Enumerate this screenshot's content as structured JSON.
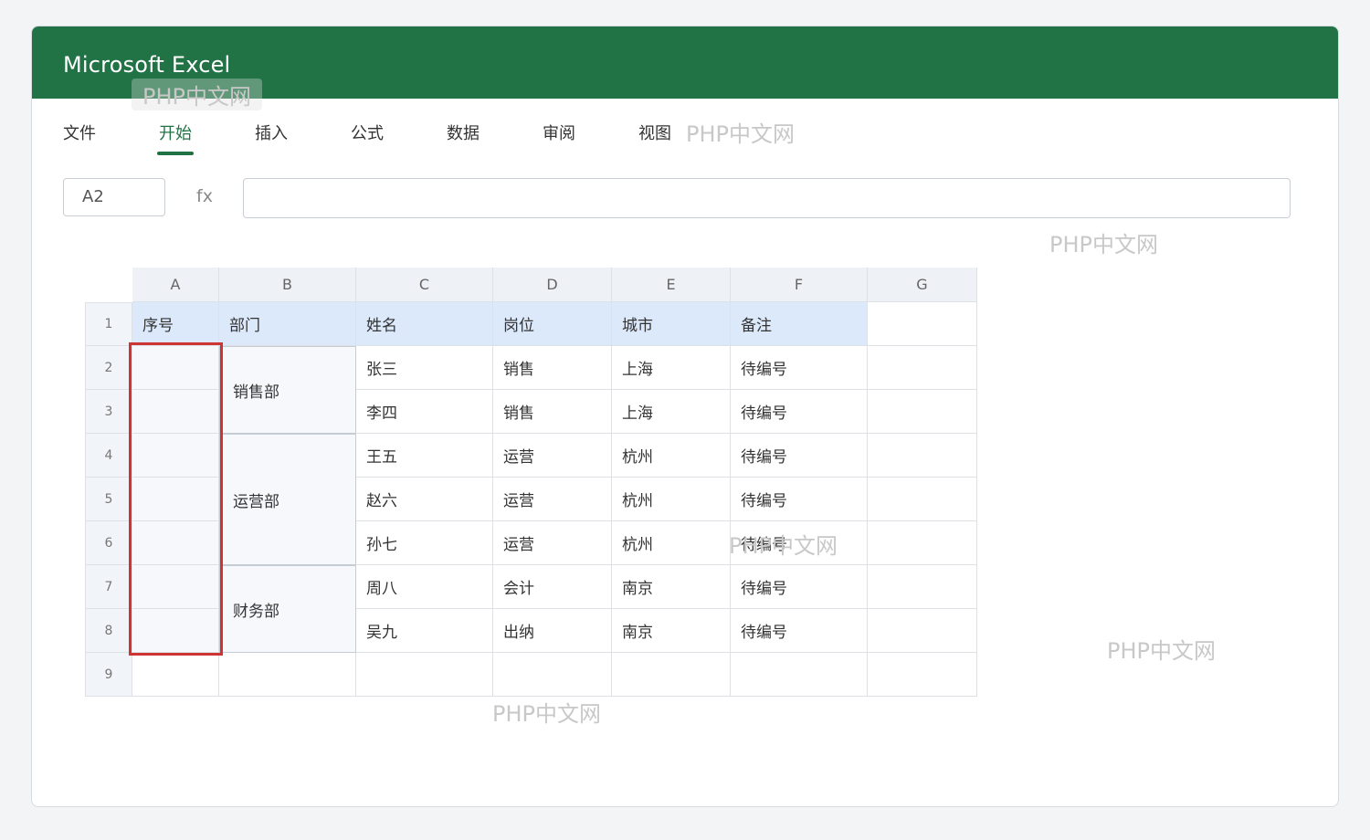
{
  "app": {
    "title": "Microsoft Excel"
  },
  "ribbon": {
    "tabs": [
      {
        "label": "文件",
        "active": false
      },
      {
        "label": "开始",
        "active": true
      },
      {
        "label": "插入",
        "active": false
      },
      {
        "label": "公式",
        "active": false
      },
      {
        "label": "数据",
        "active": false
      },
      {
        "label": "审阅",
        "active": false
      },
      {
        "label": "视图",
        "active": false
      }
    ]
  },
  "formula_bar": {
    "cell_ref": "A2",
    "fx_label": "fx",
    "value": ""
  },
  "sheet": {
    "column_headers": [
      "A",
      "B",
      "C",
      "D",
      "E",
      "F",
      "G"
    ],
    "row_headers": [
      "1",
      "2",
      "3",
      "4",
      "5",
      "6",
      "7",
      "8",
      "9"
    ],
    "header_row": [
      "序号",
      "部门",
      "姓名",
      "岗位",
      "城市",
      "备注",
      ""
    ],
    "merged_departments": [
      {
        "label": "销售部",
        "rows": "2-3"
      },
      {
        "label": "运营部",
        "rows": "4-6"
      },
      {
        "label": "财务部",
        "rows": "7-8"
      }
    ],
    "rows": [
      {
        "name": "张三",
        "role": "销售",
        "city": "上海",
        "note": "待编号"
      },
      {
        "name": "李四",
        "role": "销售",
        "city": "上海",
        "note": "待编号"
      },
      {
        "name": "王五",
        "role": "运营",
        "city": "杭州",
        "note": "待编号"
      },
      {
        "name": "赵六",
        "role": "运营",
        "city": "杭州",
        "note": "待编号"
      },
      {
        "name": "孙七",
        "role": "运营",
        "city": "杭州",
        "note": "待编号"
      },
      {
        "name": "周八",
        "role": "会计",
        "city": "南京",
        "note": "待编号"
      },
      {
        "name": "吴九",
        "role": "出纳",
        "city": "南京",
        "note": "待编号"
      }
    ],
    "selected_range": "A2:A8"
  },
  "watermarks": [
    "PHP中文网",
    "PHP中文网",
    "PHP中文网",
    "PHP中文网",
    "PHP中文网",
    "PHP中文网"
  ],
  "colors": {
    "brand": "#217346",
    "selection": "#cf3434",
    "header_fill": "#dbe9fb"
  }
}
